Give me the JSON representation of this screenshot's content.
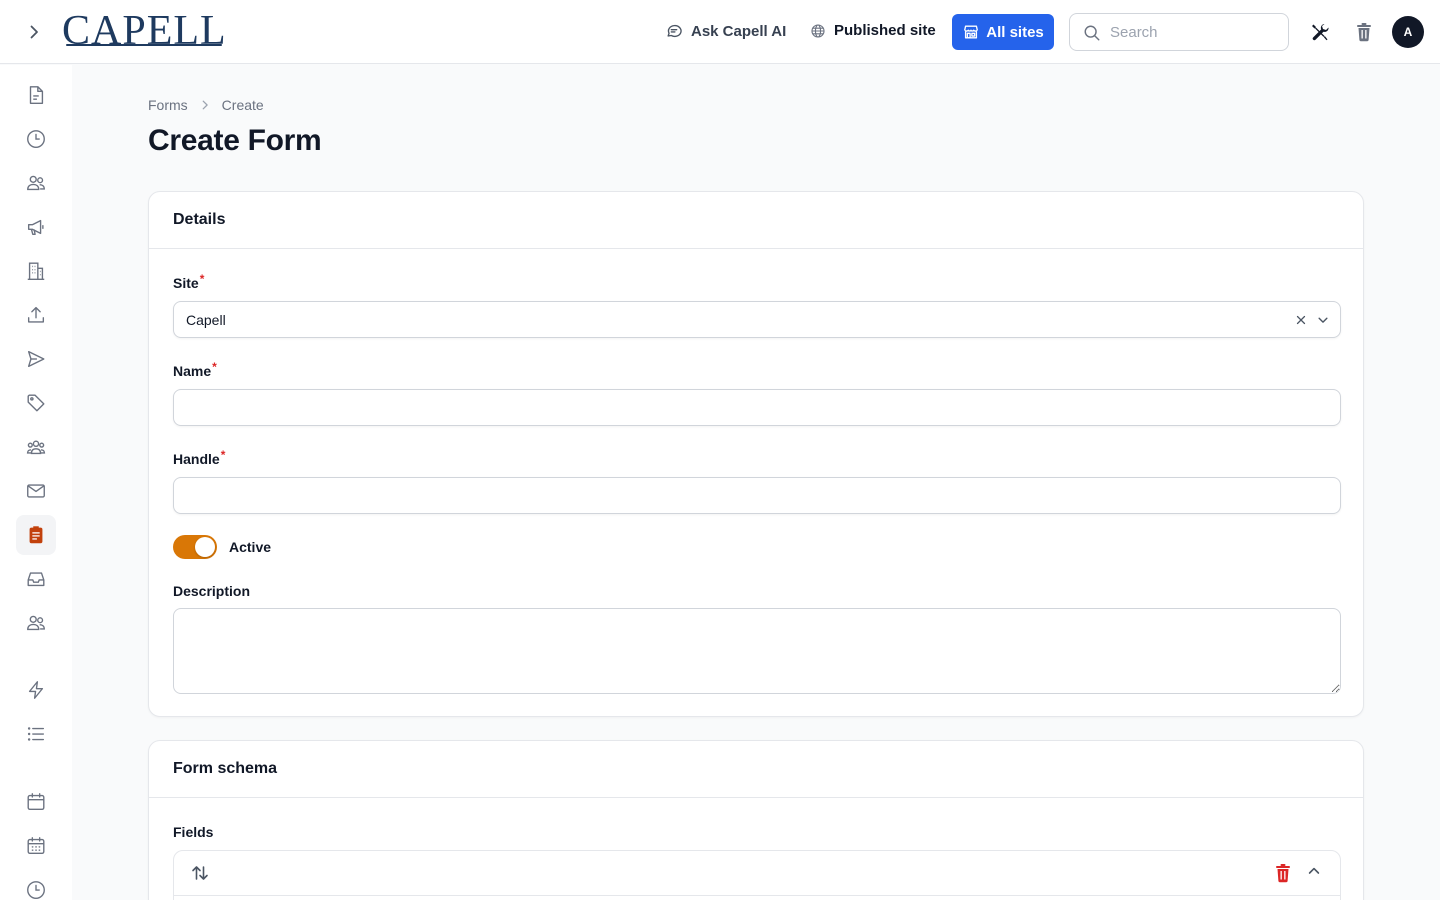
{
  "header": {
    "logo": "CAPELL",
    "ask_ai": "Ask Capell AI",
    "published_site": "Published site",
    "all_sites": "All sites",
    "search_placeholder": "Search",
    "avatar_initial": "A"
  },
  "sidebar": {
    "items": [
      {
        "icon": "document-icon",
        "active": false
      },
      {
        "icon": "clock-icon",
        "active": false
      },
      {
        "icon": "users-icon",
        "active": false
      },
      {
        "icon": "megaphone-icon",
        "active": false
      },
      {
        "icon": "building-icon",
        "active": false
      },
      {
        "icon": "upload-icon",
        "active": false
      },
      {
        "icon": "paper-plane-icon",
        "active": false
      },
      {
        "icon": "tag-icon",
        "active": false
      },
      {
        "icon": "user-group-icon",
        "active": false
      },
      {
        "icon": "envelope-icon",
        "active": false
      },
      {
        "icon": "clipboard-icon",
        "active": true
      },
      {
        "icon": "inbox-icon",
        "active": false
      },
      {
        "icon": "users-icon",
        "active": false
      },
      {
        "icon": "bolt-icon",
        "active": false
      },
      {
        "icon": "list-icon",
        "active": false
      },
      {
        "icon": "calendar-icon",
        "active": false
      },
      {
        "icon": "calendar-days-icon",
        "active": false
      },
      {
        "icon": "clock-icon",
        "active": false
      }
    ],
    "accent": "#c2410c"
  },
  "breadcrumb": {
    "parent": "Forms",
    "current": "Create"
  },
  "page": {
    "title": "Create Form"
  },
  "details": {
    "heading": "Details",
    "site_label": "Site",
    "site_value": "Capell",
    "name_label": "Name",
    "name_value": "",
    "handle_label": "Handle",
    "handle_value": "",
    "active_label": "Active",
    "active": true,
    "description_label": "Description",
    "description_value": "",
    "required_mark": "*"
  },
  "schema": {
    "heading": "Form schema",
    "fields_label": "Fields"
  },
  "colors": {
    "primary": "#2563eb",
    "toggle_on": "#d97706",
    "danger": "#dc2626",
    "logo": "#1e3a5f"
  }
}
